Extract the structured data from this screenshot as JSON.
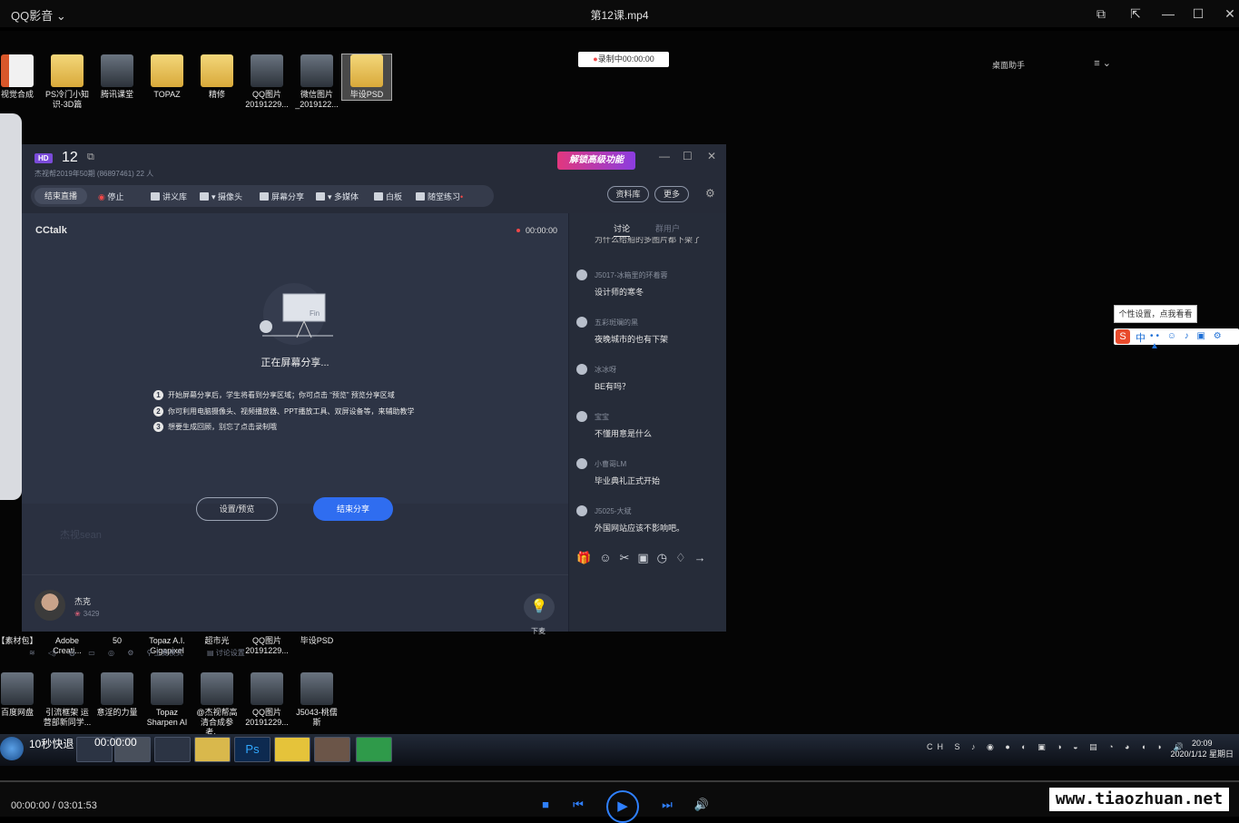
{
  "player": {
    "brand": "QQ影音",
    "brand_caret": "⌄",
    "filename": "第12课.mp4",
    "time_readout": "00:00:00 / 03:01:53",
    "progress": 0.0,
    "overlay_quit": "10秒快退",
    "overlay_time": "00:00:00",
    "watermark": "www.tiaozhuan.net"
  },
  "desktop": {
    "rec_badge": "录制中00:00:00",
    "helper_label": "桌面助手",
    "helper_menu": "≡ ⌄",
    "tip_bubble": "个性设置，点我看看",
    "ime_s": "S",
    "ime_zh": "中",
    "ime_dots": "•• ☺ ♪ ▣ ⚙ ▲",
    "top_icons": [
      {
        "label": "视觉合成",
        "kind": "ppt"
      },
      {
        "label": "PS冷门小知识-3D篇",
        "kind": "folder"
      },
      {
        "label": "腾讯课堂",
        "kind": "img"
      },
      {
        "label": "TOPAZ",
        "kind": "folder"
      },
      {
        "label": "精修",
        "kind": "folder"
      },
      {
        "label": "QQ图片20191229...",
        "kind": "img"
      },
      {
        "label": "微信图片_2019122...",
        "kind": "img"
      },
      {
        "label": "毕设PSD",
        "kind": "folder"
      }
    ],
    "mid_icons": [
      {
        "label": "【素材包】"
      },
      {
        "label": "Adobe Creati..."
      },
      {
        "label": "50"
      },
      {
        "label": "Topaz A.I. Gigapixel"
      },
      {
        "label": "超市光"
      },
      {
        "label": "QQ图片20191229..."
      },
      {
        "label": "毕设PSD"
      }
    ],
    "bottom_icons": [
      {
        "label": "百度网盘"
      },
      {
        "label": "引流框架 运营部新同学..."
      },
      {
        "label": "意淫的力量"
      },
      {
        "label": "Topaz Sharpen AI"
      },
      {
        "label": "@杰视帮高清合成参考、..."
      },
      {
        "label": "QQ图片20191229..."
      },
      {
        "label": "J5043-桃儒斯"
      }
    ]
  },
  "cctalk": {
    "hd_badge": "HD",
    "room_number": "12",
    "subtitle": "杰视帮2019年50期 (86897461)   22 人",
    "unlock": "解锁高级功能",
    "window_min": "—",
    "window_max": "☐",
    "window_close": "✕",
    "toolbar": {
      "end_live": "结束直播",
      "stop": "停止",
      "lecture": "讲义库",
      "camera": "摄像头",
      "screen_share": "屏幕分享",
      "media": "多媒体",
      "whiteboard": "白板",
      "exercise": "随堂练习"
    },
    "materials": "资料库",
    "more": "更多",
    "logo": "CCtalk",
    "timer": "00:00:00",
    "sharing_text": "正在屏幕分享...",
    "illus_label": "Fin",
    "steps": [
      {
        "n": "1",
        "text": "开始屏幕分享后，学生将看到分享区域；你可点击 “预览” 预览分享区域"
      },
      {
        "n": "2",
        "text": "你可利用电脑摄像头、视频播放器、PPT播放工具、双屏设备等，来辅助教学"
      },
      {
        "n": "3",
        "text": "想要生成回顾，别忘了点击录制哦"
      }
    ],
    "settings_preview": "设置/预览",
    "end_share": "结束分享",
    "watermark": "杰视sean",
    "host_name": "杰克",
    "host_score": "3429",
    "down_label": "下麦",
    "status": [
      "上麦模式",
      "讨论设置"
    ],
    "chat": {
      "tab_discuss": "讨论",
      "tab_members": "群用户",
      "clip": "为什么给船的多图片都下架了",
      "messages": [
        {
          "name": "J5017-冰箱里的环着蓉",
          "text": "设计师的寒冬"
        },
        {
          "name": "五彩斑斓的黑",
          "text": "夜晚城市的也有下架"
        },
        {
          "name": "冰冰呀",
          "text": "BE有吗？"
        },
        {
          "name": "宝宝",
          "text": "不懂用意是什么"
        },
        {
          "name": "小曹哥LM",
          "text": "毕业典礼正式开始"
        },
        {
          "name": "J5025-大斌",
          "text": "外国网站应该不影响吧。"
        }
      ],
      "tools": "🎁☺✂▣◷♢→"
    }
  },
  "taskbar": {
    "clock_time": "20:09",
    "clock_date": "2020/1/12 星期日",
    "tray": "CH S ♪ ◉ ● ◐ ▣ ◑ ◒ ▤ ◔ ◕ ◖ ◗ 🔊"
  },
  "icons": {
    "pip": "pip-icon",
    "pin": "pin-icon",
    "minimize": "minimize-icon",
    "maximize": "maximize-icon",
    "close": "close-icon",
    "stop": "stop-icon",
    "prev": "previous-icon",
    "play": "play-icon",
    "next": "next-icon",
    "volume": "volume-icon"
  },
  "colors": {
    "accent": "#2f80ff",
    "cc_primary": "#2f6df0",
    "cc_bg": "#2a3040",
    "record_red": "#f04848"
  }
}
